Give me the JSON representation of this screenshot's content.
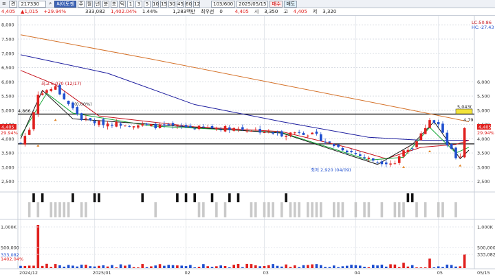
{
  "toolbar": {
    "menu_glyph": "≡",
    "mode": "켠",
    "code": "217330",
    "search_icon": "magnifier-icon",
    "name": "싸이토젠",
    "periods": [
      "주",
      "월",
      "년",
      "분",
      "초",
      "틱"
    ],
    "intervals": [
      "1",
      "3",
      "5",
      "10",
      "15",
      "30",
      "45",
      "60",
      "12"
    ],
    "count": "103/600",
    "date": "2025/05/15",
    "buy": "매수",
    "sell": "매도"
  },
  "info": {
    "price": "4,405",
    "change": "1,015",
    "change_pct": "+29.94%",
    "volume": "333,082",
    "volume_change": "1,402.04%",
    "turnover": "1.44%",
    "amount": "1,283백만",
    "pref_label": "최우선",
    "pref_val": "0",
    "last": "4,405",
    "open_label": "시",
    "open": "3,350",
    "high_label": "고",
    "high": "4,405",
    "low_label": "저",
    "low": "3,320"
  },
  "colors": {
    "up": "#e0201e",
    "down": "#1f4fcf",
    "ma5": "#1a1a1a",
    "ma10": "#11a533",
    "ma20": "#c5111b",
    "ma60": "#1c1c9e",
    "ma120": "#d5722a"
  },
  "price_axis": {
    "labels": [
      "8,000",
      "7,500",
      "7,000",
      "6,500",
      "6,000",
      "5,500",
      "5,000",
      "4,500",
      "4,000",
      "3,500",
      "3,000",
      "2,500"
    ],
    "values": [
      8000,
      7500,
      7000,
      6500,
      6000,
      5500,
      5000,
      4500,
      4000,
      3500,
      3000,
      2500
    ],
    "min": 2300,
    "max": 8150
  },
  "right_axis": {
    "labels": [
      "6,000",
      "5,500",
      "5,000",
      "4,500",
      "4,000",
      "3,500",
      "3,000",
      "2,500"
    ],
    "values": [
      6000,
      5500,
      5000,
      4500,
      4000,
      3500,
      3000,
      2500
    ]
  },
  "right_tags": {
    "lc": "LC:50.86",
    "hc": "HC:-27.43"
  },
  "left_tags": {
    "price": "4,405",
    "pct": "29.94%",
    "level": "4,866"
  },
  "annotations": {
    "high": "최고 6,070 (12/17)",
    "low": "최저 2,920 (04/09)",
    "retrace": "(0.00%)",
    "target": "5,043(",
    "side": "4,79"
  },
  "h_lines": [
    4866,
    3820
  ],
  "volume_axis": {
    "labels": [
      "1,000K",
      "500,000",
      "333,082"
    ],
    "values": [
      1000000,
      500000,
      333082
    ],
    "left": [
      "1,000K",
      "500,000",
      "333,082",
      "1402.04%"
    ]
  },
  "dates": [
    "2024/12",
    "2025/01",
    "02",
    "03",
    "04",
    "05",
    "05/15"
  ]
}
